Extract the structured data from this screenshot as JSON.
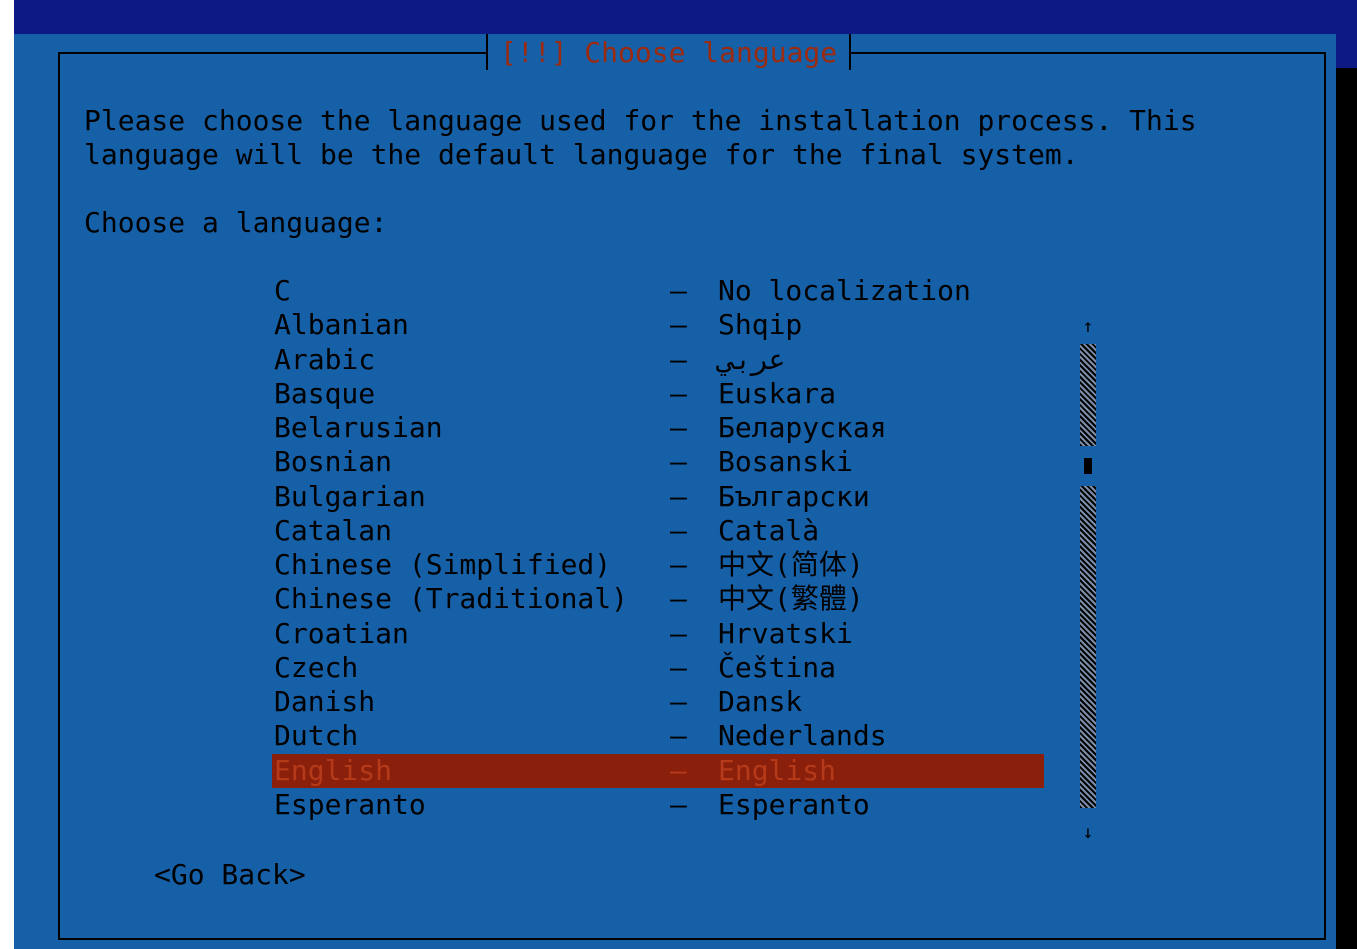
{
  "dialog": {
    "title": "[!!] Choose language",
    "description_line1": "Please choose the language used for the installation process. This",
    "description_line2": "language will be the default language for the final system.",
    "prompt": "Choose a language:"
  },
  "languages": [
    {
      "name": "C",
      "native": "No localization"
    },
    {
      "name": "Albanian",
      "native": "Shqip"
    },
    {
      "name": "Arabic",
      "native": "عربي"
    },
    {
      "name": "Basque",
      "native": "Euskara"
    },
    {
      "name": "Belarusian",
      "native": "Беларуская"
    },
    {
      "name": "Bosnian",
      "native": "Bosanski"
    },
    {
      "name": "Bulgarian",
      "native": "Български"
    },
    {
      "name": "Catalan",
      "native": "Català"
    },
    {
      "name": "Chinese (Simplified)",
      "native": "中文(简体)"
    },
    {
      "name": "Chinese (Traditional)",
      "native": "中文(繁體)"
    },
    {
      "name": "Croatian",
      "native": "Hrvatski"
    },
    {
      "name": "Czech",
      "native": "Čeština"
    },
    {
      "name": "Danish",
      "native": "Dansk"
    },
    {
      "name": "Dutch",
      "native": "Nederlands"
    },
    {
      "name": "English",
      "native": "English"
    },
    {
      "name": "Esperanto",
      "native": "Esperanto"
    }
  ],
  "separator": "–",
  "selected_language": "English",
  "scrollbar": {
    "up_arrow": "↑",
    "down_arrow": "↓"
  },
  "go_back_label": "<Go Back>",
  "colors": {
    "background": "#0d1a85",
    "dialog": "#1660a8",
    "selection": "#8a1f0b",
    "title": "#9b2a10"
  }
}
